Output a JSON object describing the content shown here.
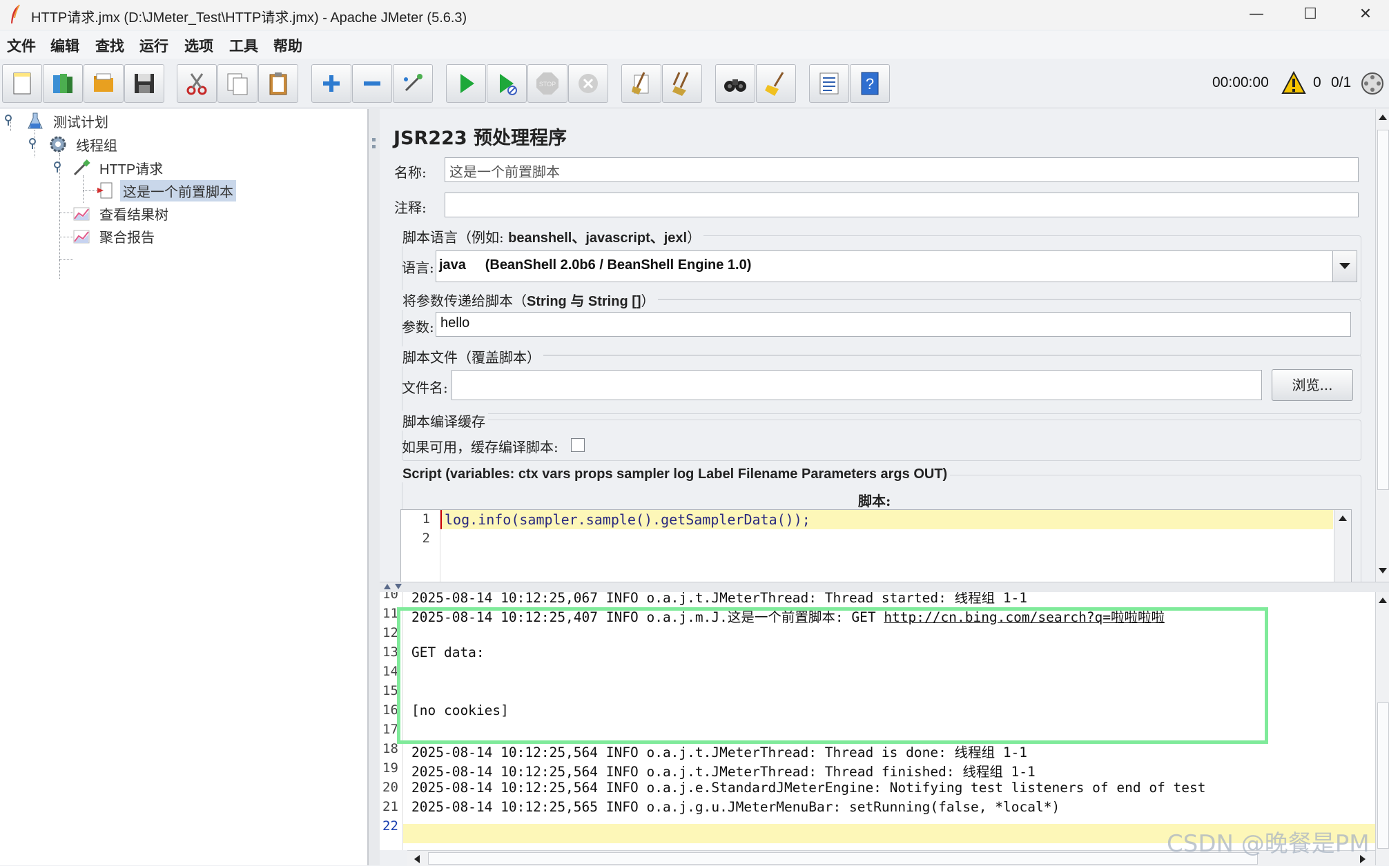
{
  "window": {
    "title": "HTTP请求.jmx (D:\\JMeter_Test\\HTTP请求.jmx) - Apache JMeter (5.6.3)",
    "controls": {
      "minimize": "—",
      "maximize": "☐",
      "close": "✕"
    }
  },
  "menu": [
    "文件",
    "编辑",
    "查找",
    "运行",
    "选项",
    "工具",
    "帮助"
  ],
  "toolbar": {
    "buttons": [
      "new",
      "templates",
      "open",
      "save",
      "cut",
      "copy",
      "paste",
      "expand",
      "collapse",
      "toggle",
      "start",
      "start-no-pause",
      "stop",
      "shutdown",
      "clear",
      "clear-all",
      "search",
      "reset-search",
      "function-helper",
      "help"
    ],
    "timer": "00:00:00",
    "warn_count": "0",
    "threads": "0/1"
  },
  "tree": {
    "items": [
      {
        "label": "测试计划",
        "icon": "flask-icon"
      },
      {
        "label": "线程组",
        "icon": "gear-icon"
      },
      {
        "label": "HTTP请求",
        "icon": "pipette-icon"
      },
      {
        "label": "这是一个前置脚本",
        "icon": "script-icon",
        "selected": true
      },
      {
        "label": "查看结果树",
        "icon": "chart-icon"
      },
      {
        "label": "聚合报告",
        "icon": "chart-icon"
      }
    ]
  },
  "panel": {
    "title": "JSR223 预处理程序",
    "name_label": "名称:",
    "name_value": "这是一个前置脚本",
    "comment_label": "注释:",
    "comment_value": "",
    "lang_group_prefix": "脚本语言（例如: ",
    "lang_group_bold": "beanshell、javascript、jexl",
    "lang_group_suffix": "）",
    "lang_label": "语言:",
    "lang_value": "java     (BeanShell 2.0b6 / BeanShell Engine 1.0)",
    "params_group_prefix": "将参数传递给脚本（",
    "params_group_bold": "String 与 String []",
    "params_group_suffix": "）",
    "params_label": "参数:",
    "params_value": "hello",
    "file_group": "脚本文件（覆盖脚本）",
    "file_label": "文件名:",
    "file_value": "",
    "browse_button": "浏览...",
    "cache_group": "脚本编译缓存",
    "cache_label": "如果可用，缓存编译脚本:",
    "script_group": "Script (variables: ctx vars props sampler log Label Filename Parameters args OUT)",
    "script_label": "脚本:",
    "code_lines": [
      {
        "num": "1",
        "text": "log.info(sampler.sample().getSamplerData());"
      },
      {
        "num": "2",
        "text": ""
      }
    ]
  },
  "log": {
    "lines": [
      {
        "num": "10",
        "text": "2025-08-14 10:12:25,067 INFO o.a.j.t.JMeterThread: Thread started: 线程组 1-1"
      },
      {
        "num": "11",
        "text": "2025-08-14 10:12:25,407 INFO o.a.j.m.J.这是一个前置脚本: GET ",
        "link": "http://cn.bing.com/search?q=啦啦啦啦"
      },
      {
        "num": "12",
        "text": ""
      },
      {
        "num": "13",
        "text": "GET data:"
      },
      {
        "num": "14",
        "text": ""
      },
      {
        "num": "15",
        "text": ""
      },
      {
        "num": "16",
        "text": "[no cookies]"
      },
      {
        "num": "17",
        "text": ""
      },
      {
        "num": "18",
        "text": "2025-08-14 10:12:25,564 INFO o.a.j.t.JMeterThread: Thread is done: 线程组 1-1"
      },
      {
        "num": "19",
        "text": "2025-08-14 10:12:25,564 INFO o.a.j.t.JMeterThread: Thread finished: 线程组 1-1"
      },
      {
        "num": "20",
        "text": "2025-08-14 10:12:25,564 INFO o.a.j.e.StandardJMeterEngine: Notifying test listeners of end of test"
      },
      {
        "num": "21",
        "text": "2025-08-14 10:12:25,565 INFO o.a.j.g.u.JMeterMenuBar: setRunning(false, *local*)"
      },
      {
        "num": "22",
        "text": ""
      }
    ]
  },
  "watermark": "CSDN @晚餐是PM",
  "colors": {
    "highlight_box": "#7fea9a",
    "current_line": "#fdf7b8",
    "selection": "#c9d7ea"
  }
}
